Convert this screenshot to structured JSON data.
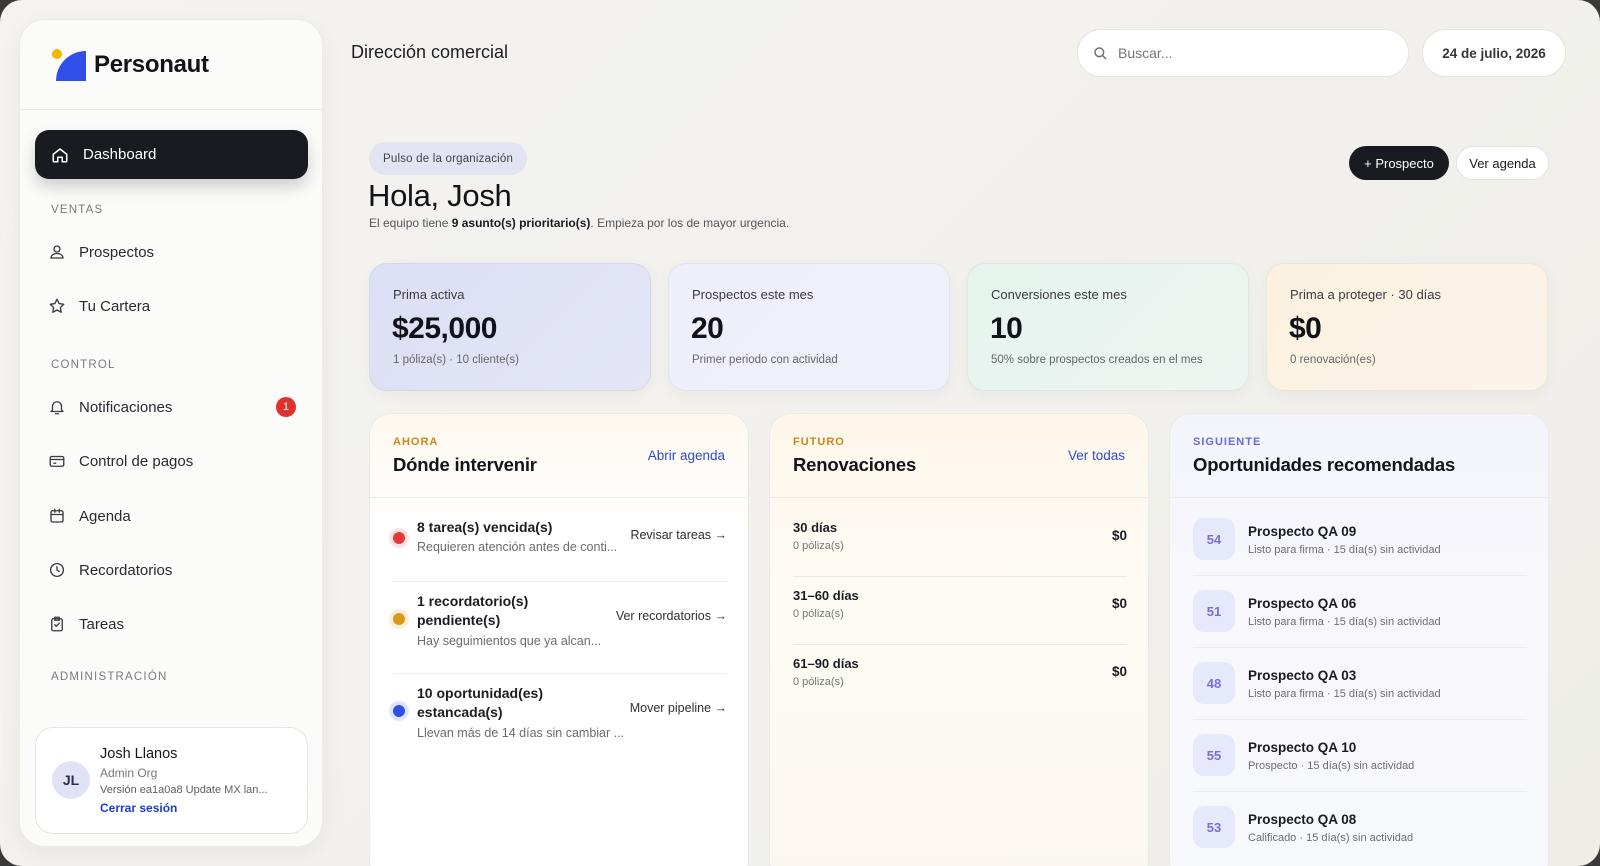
{
  "brand": {
    "name": "Personaut"
  },
  "header": {
    "title": "Dirección comercial",
    "search_placeholder": "Buscar...",
    "date": "24 de julio, 2026"
  },
  "sidebar": {
    "active": {
      "label": "Dashboard",
      "icon": "home-icon"
    },
    "sections": [
      {
        "label": "VENTAS"
      },
      {
        "label": "CONTROL"
      },
      {
        "label": "ADMINISTRACIÓN"
      }
    ],
    "items": [
      {
        "label": "Prospectos",
        "icon": "user-icon"
      },
      {
        "label": "Tu Cartera",
        "icon": "star-icon"
      },
      {
        "label": "Notificaciones",
        "icon": "bell-icon",
        "badge": "1"
      },
      {
        "label": "Control de pagos",
        "icon": "credit-card-icon"
      },
      {
        "label": "Agenda",
        "icon": "calendar-icon"
      },
      {
        "label": "Recordatorios",
        "icon": "clock-icon"
      },
      {
        "label": "Tareas",
        "icon": "clipboard-check-icon"
      }
    ],
    "user": {
      "initials": "JL",
      "name": "Josh Llanos",
      "role": "Admin Org",
      "version": "Versión ea1a0a8 Update MX lan...",
      "logout": "Cerrar sesión"
    }
  },
  "hero": {
    "pill": "Pulso de la organización",
    "greeting": "Hola, Josh",
    "subtitle_pre": "El equipo tiene ",
    "subtitle_bold": "9 asunto(s) prioritario(s)",
    "subtitle_post": ". Empieza por los de mayor urgencia.",
    "primary_button": "+ Prospecto",
    "secondary_button": "Ver agenda"
  },
  "stats": [
    {
      "label": "Prima activa",
      "value": "$25,000",
      "sub": "1 póliza(s) · 10 cliente(s)"
    },
    {
      "label": "Prospectos este mes",
      "value": "20",
      "sub": "Primer periodo con actividad"
    },
    {
      "label": "Conversiones este mes",
      "value": "10",
      "sub": "50% sobre prospectos creados en el mes"
    },
    {
      "label": "Prima a proteger · 30 días",
      "value": "$0",
      "sub": "0 renovación(es)"
    }
  ],
  "panels": {
    "intervenir": {
      "kicker": "AHORA",
      "title": "Dónde intervenir",
      "link": "Abrir agenda",
      "rows": [
        {
          "title_1": "8 tarea(s) vencida(s)",
          "title_2": "",
          "desc": "Requieren atención antes de conti...",
          "action": "Revisar tareas →",
          "color": "#e03a3a"
        },
        {
          "title_1": "1 recordatorio(s)",
          "title_2": "pendiente(s)",
          "desc": "Hay seguimientos que ya alcan...",
          "action": "Ver recordatorios →",
          "color": "#d99a1a"
        },
        {
          "title_1": "10 oportunidad(es)",
          "title_2": "estancada(s)",
          "desc": "Llevan más de 14 días sin cambiar ...",
          "action": "Mover pipeline →",
          "color": "#2f4fe8"
        }
      ]
    },
    "renovaciones": {
      "kicker": "FUTURO",
      "title": "Renovaciones",
      "link": "Ver todas",
      "rows": [
        {
          "label": "30 días",
          "sub": "0 póliza(s)",
          "value": "$0"
        },
        {
          "label": "31–60 días",
          "sub": "0 póliza(s)",
          "value": "$0"
        },
        {
          "label": "61–90 días",
          "sub": "0 póliza(s)",
          "value": "$0"
        }
      ]
    },
    "oportunidades": {
      "kicker": "SIGUIENTE",
      "title": "Oportunidades recomendadas",
      "rows": [
        {
          "score": "54",
          "name": "Prospecto QA 09",
          "sub": "Listo para firma · 15 día(s) sin actividad"
        },
        {
          "score": "51",
          "name": "Prospecto QA 06",
          "sub": "Listo para firma · 15 día(s) sin actividad"
        },
        {
          "score": "48",
          "name": "Prospecto QA 03",
          "sub": "Listo para firma · 15 día(s) sin actividad"
        },
        {
          "score": "55",
          "name": "Prospecto QA 10",
          "sub": "Prospecto · 15 día(s) sin actividad"
        },
        {
          "score": "53",
          "name": "Prospecto QA 08",
          "sub": "Calificado · 15 día(s) sin actividad"
        }
      ]
    }
  },
  "colors": {
    "accent": "#2f4fe8",
    "dark": "#1a1b21",
    "badge": "#e03131",
    "kicker_ahora": "#c8871a",
    "kicker_futuro": "#c8871a",
    "kicker_siguiente": "#6a6ad0"
  }
}
